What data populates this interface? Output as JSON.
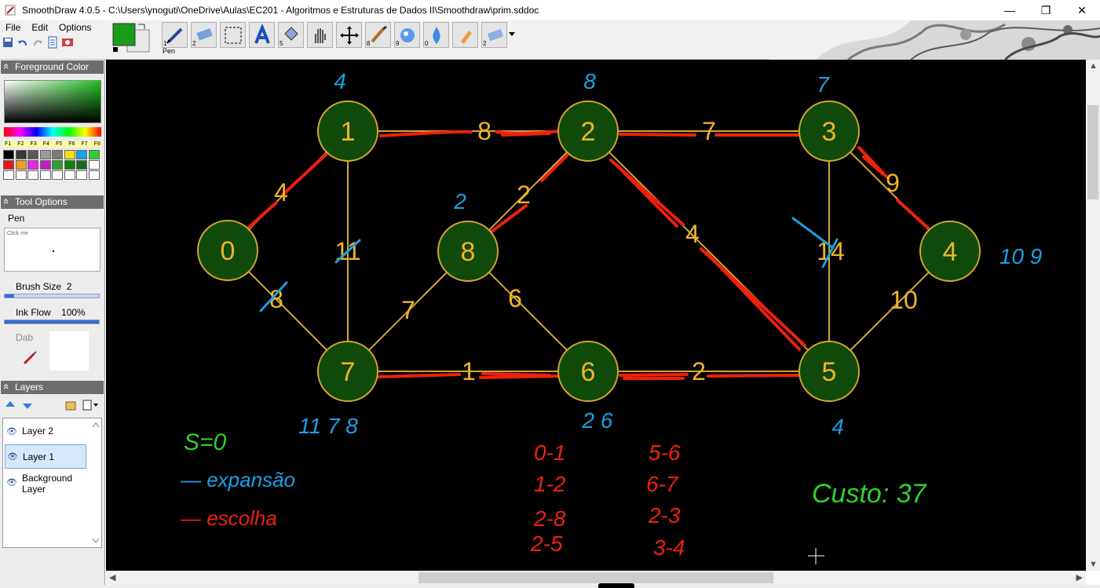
{
  "window": {
    "title": "SmoothDraw 4.0.5 - C:\\Users\\ynoguti\\OneDrive\\Aulas\\EC201 - Algoritmos e Estruturas de Dados II\\Smoothdraw\\prim.sddoc",
    "minimize": "—",
    "maximize": "❐",
    "close": "✕"
  },
  "menu": {
    "file": "File",
    "edit": "Edit",
    "options": "Options"
  },
  "toolbar": {
    "current_tool_label": "Pen",
    "foreground_color": "#1a9b1a",
    "background_color": "#e8e8e8",
    "tool_numbers": [
      "1",
      "2",
      "",
      "",
      "5",
      "",
      "",
      "",
      "8",
      "9",
      "0",
      "",
      "",
      "2"
    ]
  },
  "panels": {
    "foreground_color": {
      "title": "Foreground Color",
      "fkeys": [
        "F1",
        "F2",
        "F3",
        "F4",
        "F5",
        "F6",
        "F7",
        "F8"
      ],
      "palette": [
        "#000000",
        "#3a3a3a",
        "#5a5a5a",
        "#9a9a9a",
        "#7a7a7a",
        "#f0e010",
        "#18a0e8",
        "#30d030",
        "#e81818",
        "#f0a020",
        "#f020f0",
        "#c818c8",
        "#30a030",
        "#108010",
        "#1a6a1a",
        "#ffffff",
        "#ffffff",
        "#ffffff",
        "#ffffff",
        "#ffffff",
        "#ffffff",
        "#ffffff",
        "#ffffff",
        "#ffffff"
      ]
    },
    "tool_options": {
      "title": "Tool Options",
      "tool_name": "Pen",
      "click_me": "Click me",
      "brush_size_label": "Brush Size",
      "brush_size_value": "2",
      "brush_size_fraction": 0.1,
      "ink_flow_label": "Ink Flow",
      "ink_flow_value": "100%",
      "ink_flow_fraction": 1.0,
      "dab_label": "Dab"
    },
    "layers": {
      "title": "Layers",
      "items": [
        {
          "name": "Layer 2",
          "selected": false
        },
        {
          "name": "Layer 1",
          "selected": true
        },
        {
          "name": "Background Layer",
          "selected": false
        }
      ]
    }
  },
  "drawing": {
    "colors": {
      "node_fill": "#0f4a0b",
      "node_stroke": "#d4a530",
      "edge": "#d4a530",
      "label": "#f0b428",
      "red": "#ee2010",
      "blue": "#1aa0e6",
      "green": "#2ed12e"
    },
    "nodes": [
      "0",
      "1",
      "2",
      "3",
      "4",
      "5",
      "6",
      "7",
      "8"
    ],
    "edge_weights": {
      "e01": "4",
      "e12": "8",
      "e23": "7",
      "e34": "9",
      "e17": "11",
      "e07": "8",
      "e28": "2",
      "e25": "4",
      "e35": "14",
      "e45": "10",
      "e78": "7",
      "e86": "6",
      "e76": "1",
      "e65": "2"
    },
    "keys": {
      "k1": "4",
      "k2": "8",
      "k3": "7",
      "k8": "2",
      "k4": "10 9",
      "k7": "11 7 8",
      "k6": "2 6",
      "k5": "4"
    },
    "legend": {
      "start": "S=0",
      "expansion": "— expansão",
      "choice": "— escolha"
    },
    "chosen_edges": [
      "0-1",
      "1-2",
      "2-8",
      "2-5",
      "5-6",
      "6-7",
      "2-3",
      "3-4"
    ],
    "cost": "Custo: 37"
  }
}
